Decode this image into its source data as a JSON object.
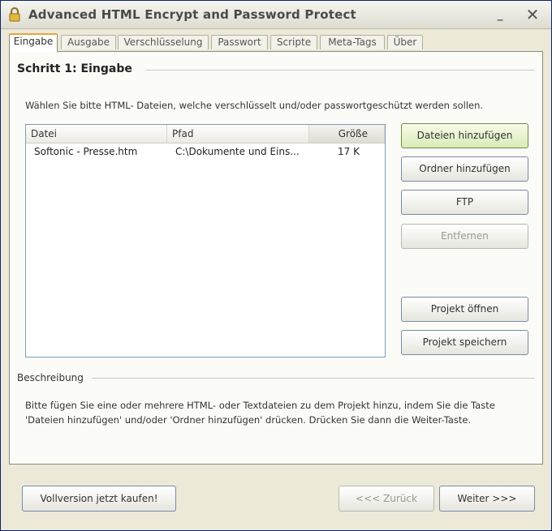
{
  "window": {
    "title": "Advanced HTML Encrypt and Password Protect",
    "minimize": "_",
    "close": "✕"
  },
  "tabs": [
    {
      "label": "Eingabe",
      "active": true
    },
    {
      "label": "Ausgabe"
    },
    {
      "label": "Verschlüsselung"
    },
    {
      "label": "Passwort"
    },
    {
      "label": "Scripte"
    },
    {
      "label": "Meta-Tags"
    },
    {
      "label": "Über"
    }
  ],
  "step": {
    "title": "Schritt 1: Eingabe",
    "instruction": "Wählen Sie bitte  HTML- Dateien, welche verschlüsselt und/oder passwortgeschützt werden sollen."
  },
  "file_list": {
    "columns": [
      "Datei",
      "Pfad",
      "Größe"
    ],
    "rows": [
      {
        "file": "Softonic - Presse.htm",
        "path": "C:\\Dokumente und Eins...",
        "size": "17 K"
      }
    ]
  },
  "actions": {
    "add_files": "Dateien hinzufügen",
    "add_folder": "Ordner hinzufügen",
    "ftp": "FTP",
    "remove": "Entfernen",
    "open_project": "Projekt öffnen",
    "save_project": "Projekt speichern"
  },
  "description": {
    "label": "Beschreibung",
    "text": "Bitte fügen Sie eine oder mehrere HTML- oder Textdateien zu dem Projekt hinzu, indem Sie die Taste 'Dateien hinzufügen' und/oder 'Ordner hinzufügen' drücken. Drücken Sie dann die Weiter-Taste."
  },
  "footer": {
    "buy": "Vollversion jetzt kaufen!",
    "back": "<<< Zurück",
    "next": "Weiter >>>"
  }
}
